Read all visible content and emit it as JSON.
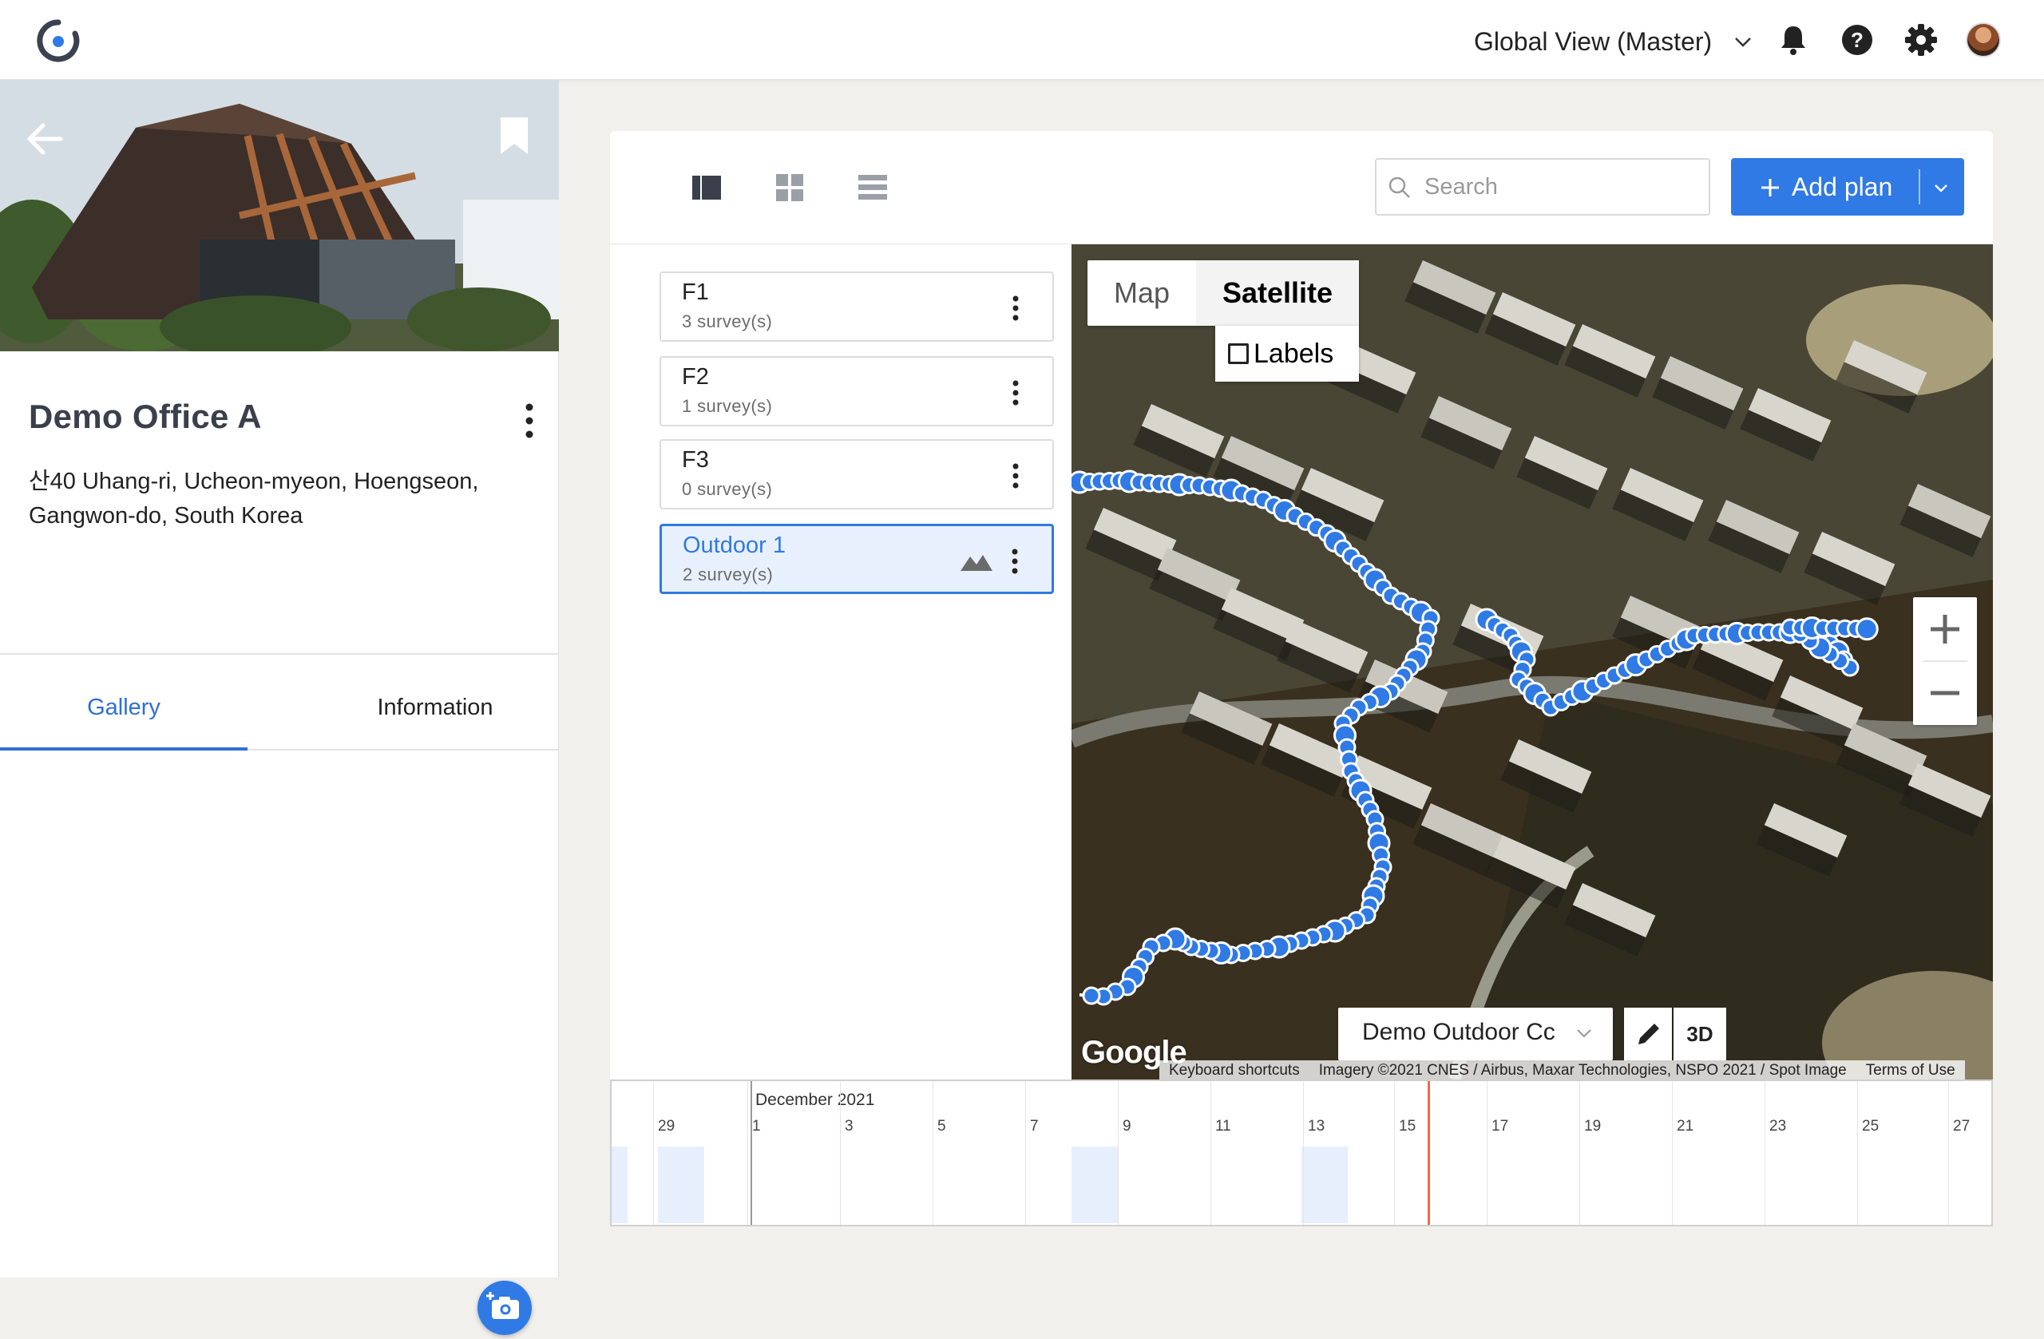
{
  "topbar": {
    "view_label": "Global View (Master)",
    "icons": [
      "logo-icon",
      "bell-icon",
      "help-icon",
      "gear-icon",
      "avatar"
    ]
  },
  "site": {
    "name": "Demo Office A",
    "address": "산40 Uhang-ri, Ucheon-myeon, Hoengseon, Gangwon-do, South Korea",
    "tabs": [
      {
        "label": "Gallery",
        "active": true
      },
      {
        "label": "Information",
        "active": false
      }
    ]
  },
  "toolbar": {
    "view_modes": [
      "split-view-icon",
      "grid-view-icon",
      "list-view-icon"
    ],
    "search_placeholder": "Search",
    "add_plan_label": "Add plan"
  },
  "plans": [
    {
      "name": "F1",
      "count": "3 survey(s)",
      "selected": false
    },
    {
      "name": "F2",
      "count": "1 survey(s)",
      "selected": false
    },
    {
      "name": "F3",
      "count": "0 survey(s)",
      "selected": false
    },
    {
      "name": "Outdoor 1",
      "count": "2 survey(s)",
      "selected": true
    }
  ],
  "map": {
    "type_map": "Map",
    "type_satellite": "Satellite",
    "active_type": "Satellite",
    "labels_label": "Labels",
    "labels_checked": false,
    "layer_label": "Demo Outdoor Cc",
    "btn_3d": "3D",
    "google": "Google",
    "attribution": {
      "shortcuts": "Keyboard shortcuts",
      "imagery": "Imagery ©2021 CNES / Airbus, Maxar Technologies, NSPO 2021 / Spot Image",
      "terms": "Terms of Use"
    },
    "accent": "#2f7ae5"
  },
  "timeline": {
    "month": "December 2021",
    "days": [
      "29",
      "1",
      "3",
      "5",
      "7",
      "9",
      "11",
      "13",
      "15",
      "17",
      "19",
      "21",
      "23",
      "25",
      "27"
    ],
    "now_color": "#f06a4a"
  }
}
